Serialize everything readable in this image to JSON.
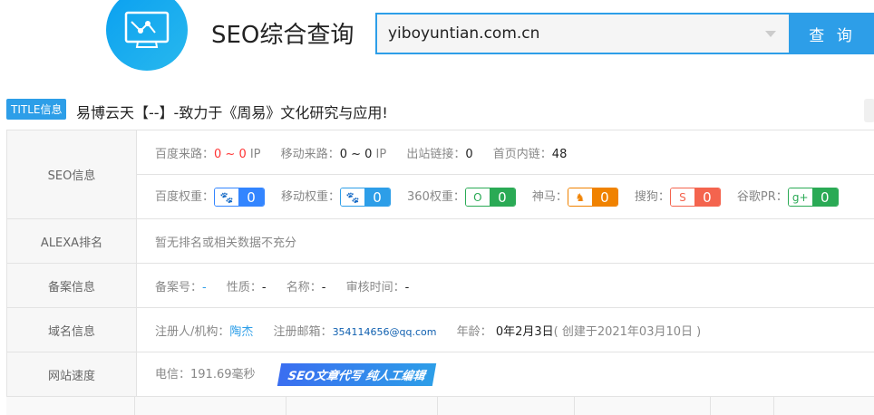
{
  "header": {
    "brand": "SEO综合查询",
    "search_value": "yiboyuntian.com.cn",
    "search_button": "查 询"
  },
  "title_row": {
    "badge": "TITLE信息",
    "text": "易博云天【--】-致力于《周易》文化研究与应用!"
  },
  "seo": {
    "label": "SEO信息",
    "traffic": [
      {
        "label": "百度来路：",
        "value": "0 ~ 0",
        "unit": " IP"
      },
      {
        "label": "移动来路：",
        "value": "0 ~ 0",
        "unit": " IP"
      },
      {
        "label": "出站链接：",
        "value": "0"
      },
      {
        "label": "首页内链：",
        "value": "48"
      }
    ],
    "weights": [
      {
        "label": "百度权重：",
        "value": "0",
        "icon": "baidu-paw-icon",
        "color": "#3385ff",
        "glyph": "🐾"
      },
      {
        "label": "移动权重：",
        "value": "0",
        "icon": "baidu-mobile-paw-icon",
        "color": "#2d9ee8",
        "glyph": "🐾"
      },
      {
        "label": "360权重：",
        "value": "0",
        "icon": "360-search-icon",
        "color": "#2aaa55",
        "glyph": "O"
      },
      {
        "label": "神马：",
        "value": "0",
        "icon": "shenma-icon",
        "color": "#f08200",
        "glyph": "♞"
      },
      {
        "label": "搜狗：",
        "value": "0",
        "icon": "sogou-icon",
        "color": "#f4644e",
        "glyph": "S"
      },
      {
        "label": "谷歌PR：",
        "value": "0",
        "icon": "google-plus-icon",
        "color": "#2aaa55",
        "glyph": "g+"
      }
    ]
  },
  "alexa": {
    "label": "ALEXA排名",
    "text": "暂无排名或相关数据不充分"
  },
  "icp": {
    "label": "备案信息",
    "items": [
      {
        "label": "备案号：",
        "value": "-"
      },
      {
        "label": "性质：",
        "value": "-"
      },
      {
        "label": "名称：",
        "value": "-"
      },
      {
        "label": "审核时间：",
        "value": "-"
      }
    ]
  },
  "domain": {
    "label": "域名信息",
    "registrant_label": "注册人/机构：",
    "registrant": "陶杰",
    "email_label": "注册邮箱：",
    "email": "354114656@qq.com",
    "age_label": "年龄：",
    "age": "0年2月3日",
    "created": "( 创建于2021年03月10日 )"
  },
  "speed": {
    "label": "网站速度",
    "text": "电信：191.69毫秒",
    "ad": "SEO文章代写  纯人工编辑"
  }
}
